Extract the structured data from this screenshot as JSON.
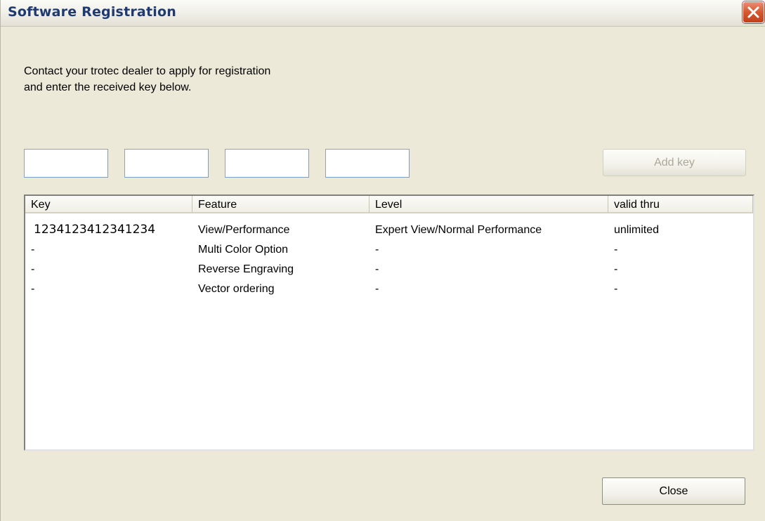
{
  "window": {
    "title": "Software Registration"
  },
  "instructions": {
    "line1": "Contact your trotec dealer to apply for registration",
    "line2": "and enter the received key below."
  },
  "key_inputs": [
    {
      "value": "",
      "placeholder": ""
    },
    {
      "value": "",
      "placeholder": ""
    },
    {
      "value": "",
      "placeholder": ""
    },
    {
      "value": "",
      "placeholder": ""
    }
  ],
  "buttons": {
    "add_key": "Add key",
    "close": "Close"
  },
  "table": {
    "columns": [
      "Key",
      "Feature",
      "Level",
      "valid thru"
    ],
    "rows": [
      [
        "1234123412341234",
        "View/Performance",
        "Expert View/Normal Performance",
        "unlimited"
      ],
      [
        "-",
        "Multi Color Option",
        "-",
        "-"
      ],
      [
        "-",
        "Reverse Engraving",
        "-",
        "-"
      ],
      [
        "-",
        "Vector ordering",
        "-",
        "-"
      ]
    ]
  },
  "icons": {
    "close": "close-icon"
  },
  "colors": {
    "dialog_bg": "#ece9d8",
    "title_text": "#1e3a70",
    "close_button": "#d4582f",
    "disabled_text": "#aca899"
  }
}
